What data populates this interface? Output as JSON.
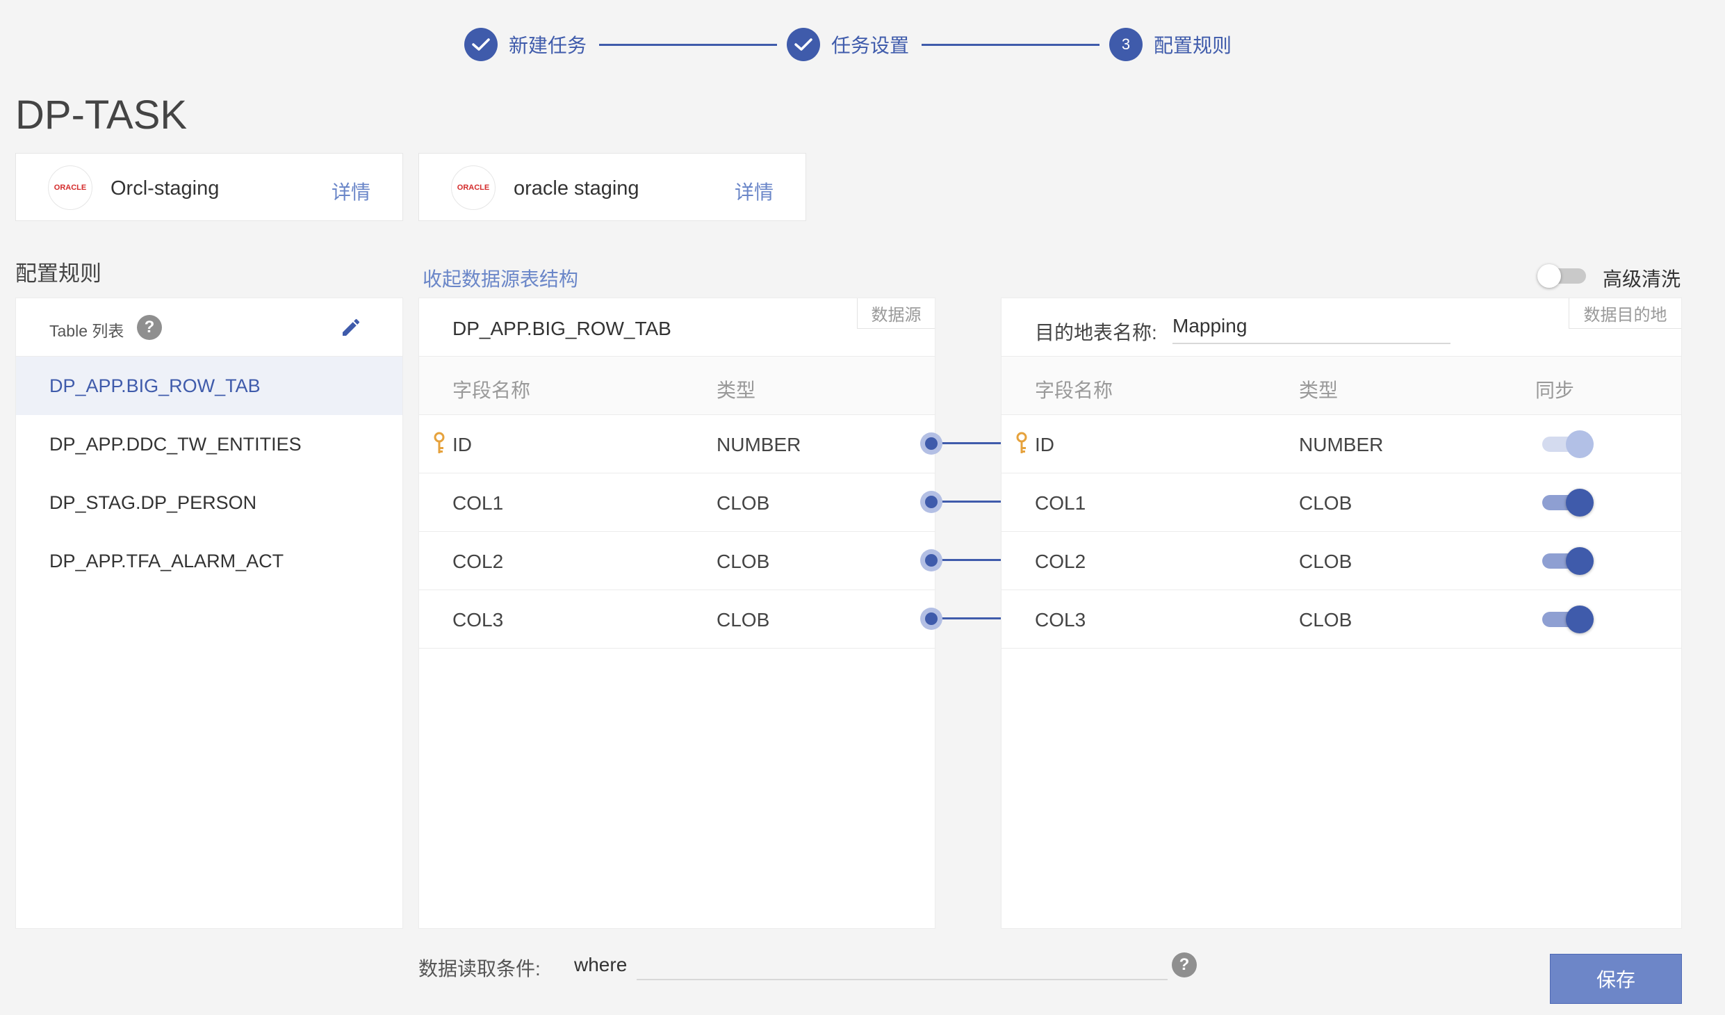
{
  "stepper": {
    "steps": [
      {
        "label": "新建任务",
        "state": "done"
      },
      {
        "label": "任务设置",
        "state": "done"
      },
      {
        "number": "3",
        "label": "配置规则",
        "state": "active"
      }
    ]
  },
  "task": {
    "title": "DP-TASK"
  },
  "datasources": [
    {
      "logo": "ORACLE",
      "name": "Orcl-staging",
      "detail_label": "详情"
    },
    {
      "logo": "ORACLE",
      "name": "oracle staging",
      "detail_label": "详情"
    }
  ],
  "rules": {
    "section_title": "配置规则",
    "collapse_link": "收起数据源表结构",
    "advanced_clean": {
      "label": "高级清洗",
      "enabled": false
    }
  },
  "table_list": {
    "header_label": "Table 列表",
    "help_symbol": "?",
    "items": [
      {
        "label": "DP_APP.BIG_ROW_TAB",
        "active": true
      },
      {
        "label": "DP_APP.DDC_TW_ENTITIES",
        "active": false
      },
      {
        "label": "DP_STAG.DP_PERSON",
        "active": false
      },
      {
        "label": "DP_APP.TFA_ALARM_ACT",
        "active": false
      }
    ]
  },
  "source": {
    "tag": "数据源",
    "table_name": "DP_APP.BIG_ROW_TAB",
    "columns": {
      "name": "字段名称",
      "type": "类型"
    },
    "rows": [
      {
        "name": "ID",
        "type": "NUMBER",
        "key": true
      },
      {
        "name": "COL1",
        "type": "CLOB",
        "key": false
      },
      {
        "name": "COL2",
        "type": "CLOB",
        "key": false
      },
      {
        "name": "COL3",
        "type": "CLOB",
        "key": false
      }
    ]
  },
  "target": {
    "tag": "数据目的地",
    "table_label": "目的地表名称:",
    "table_value": "Mapping",
    "columns": {
      "name": "字段名称",
      "type": "类型",
      "sync": "同步"
    },
    "rows": [
      {
        "name": "ID",
        "type": "NUMBER",
        "key": true,
        "sync": true,
        "sync_disabled": true
      },
      {
        "name": "COL1",
        "type": "CLOB",
        "key": false,
        "sync": true,
        "sync_disabled": false
      },
      {
        "name": "COL2",
        "type": "CLOB",
        "key": false,
        "sync": true,
        "sync_disabled": false
      },
      {
        "name": "COL3",
        "type": "CLOB",
        "key": false,
        "sync": true,
        "sync_disabled": false
      }
    ]
  },
  "condition": {
    "label": "数据读取条件:",
    "prefix": "where",
    "value": "",
    "help_symbol": "?"
  },
  "actions": {
    "save_label": "保存"
  },
  "colors": {
    "primary": "#3f5bab",
    "link": "#6a86c8",
    "button": "#6d86c8",
    "oracle_red": "#d42b2b"
  }
}
